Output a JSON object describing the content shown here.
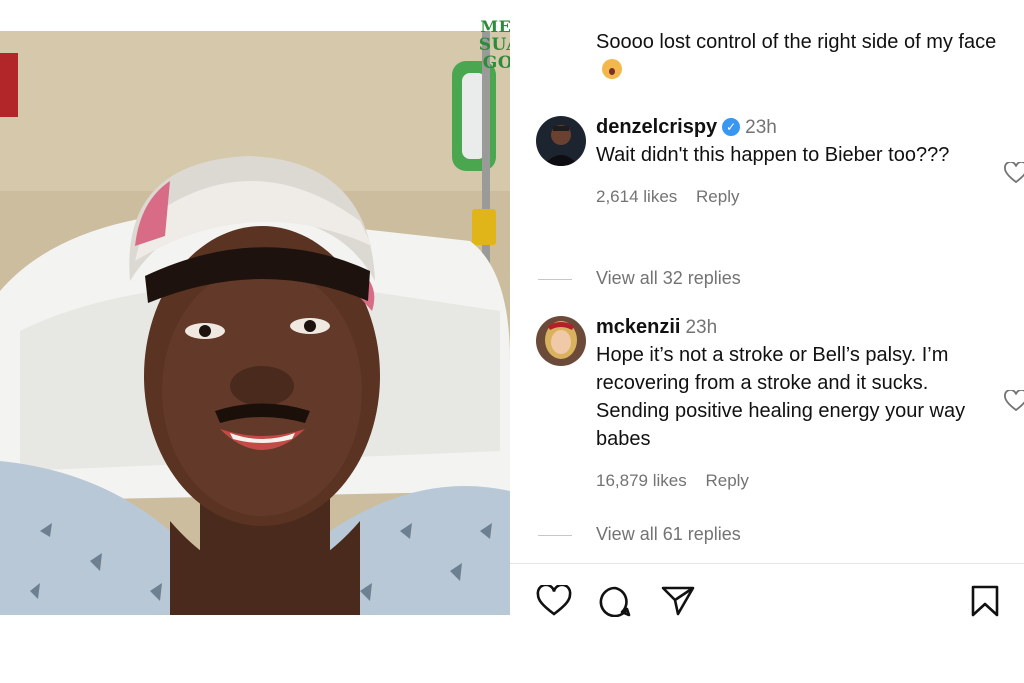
{
  "watermark": {
    "line1": "MEDIA",
    "line2": "SUARA GONG"
  },
  "caption": {
    "text": "Soooo lost control of the right side of my face",
    "emoji": "face-scream-emoji"
  },
  "comments": [
    {
      "username": "denzelcrispy",
      "verified": true,
      "time": "23h",
      "text": "Wait didn't this happen to Bieber too???",
      "likes": "2,614 likes",
      "reply": "Reply",
      "view_replies": "View all 32 replies"
    },
    {
      "username": "mckenzii",
      "verified": false,
      "time": "23h",
      "text": "Hope it’s not a stroke or Bell’s palsy. I’m recovering from a stroke and it sucks. Sending positive healing energy your way babes",
      "likes": "16,879 likes",
      "reply": "Reply",
      "view_replies": "View all 61 replies"
    }
  ],
  "actions": [
    "heart-icon",
    "comment-icon",
    "share-icon",
    "save-icon"
  ],
  "colors": {
    "verified": "#3897f0",
    "muted": "#737373",
    "watermark_green": "#2e8b3b"
  }
}
